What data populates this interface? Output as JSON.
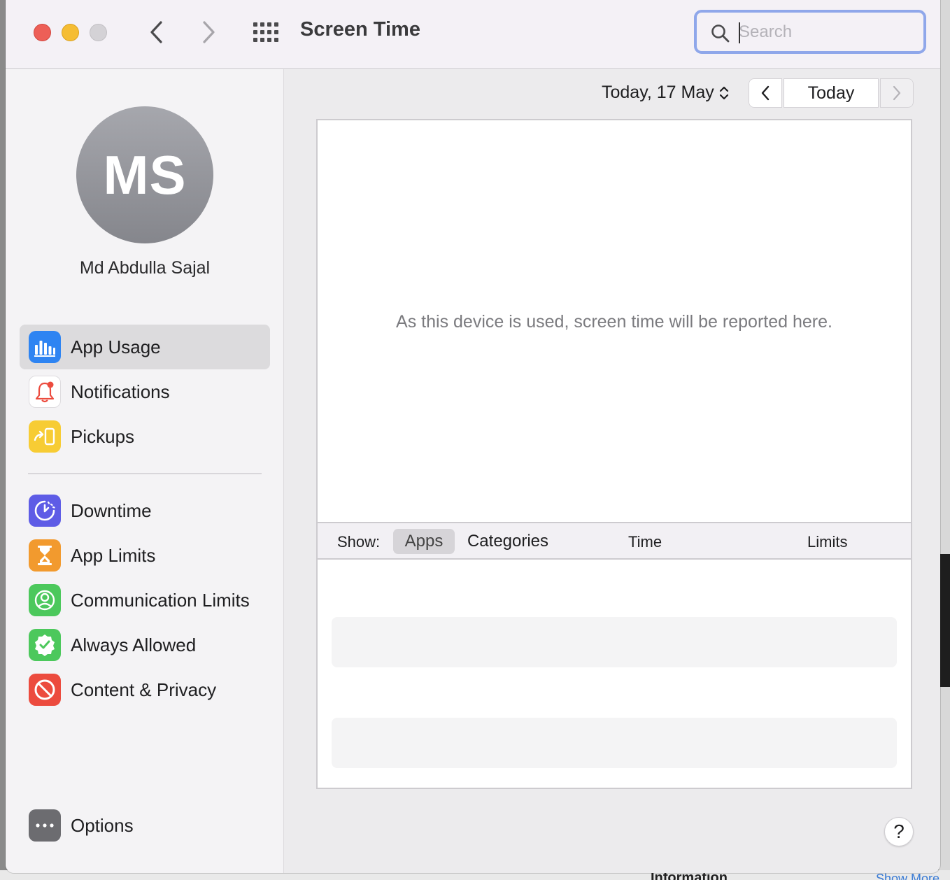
{
  "window": {
    "title": "Screen Time"
  },
  "search": {
    "placeholder": "Search",
    "value": ""
  },
  "profile": {
    "initials": "MS",
    "name": "Md Abdulla Sajal"
  },
  "sidebar": {
    "group1": [
      {
        "label": "App Usage",
        "icon": "bar-chart-icon",
        "color": "#2e84f2",
        "selected": true
      },
      {
        "label": "Notifications",
        "icon": "bell-icon",
        "color": "#ffffff",
        "selected": false
      },
      {
        "label": "Pickups",
        "icon": "pickup-phone-icon",
        "color": "#f7cc34",
        "selected": false
      }
    ],
    "group2": [
      {
        "label": "Downtime",
        "icon": "downtime-icon",
        "color": "#5e5ce6"
      },
      {
        "label": "App Limits",
        "icon": "hourglass-icon",
        "color": "#f29a2e"
      },
      {
        "label": "Communication Limits",
        "icon": "person-circle-icon",
        "color": "#4cc85c"
      },
      {
        "label": "Always Allowed",
        "icon": "checkmark-seal-icon",
        "color": "#4cc85c"
      },
      {
        "label": "Content & Privacy",
        "icon": "no-entry-icon",
        "color": "#ec4b3e"
      }
    ],
    "options": {
      "label": "Options",
      "icon": "ellipsis-icon",
      "color": "#6c6c70"
    }
  },
  "date_nav": {
    "date_label": "Today, 17 May",
    "today_label": "Today"
  },
  "main": {
    "empty_message": "As this device is used, screen time will be reported here.",
    "show_label": "Show:",
    "tab_apps": "Apps",
    "tab_categories": "Categories",
    "col_time": "Time",
    "col_limits": "Limits"
  },
  "help": {
    "label": "?"
  },
  "background": {
    "info_text": "Information",
    "more_text": "Show More"
  }
}
